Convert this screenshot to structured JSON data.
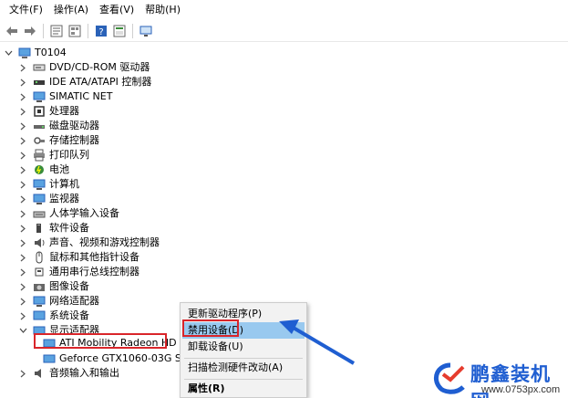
{
  "menubar": {
    "items": [
      "文件(F)",
      "操作(A)",
      "查看(V)",
      "帮助(H)"
    ]
  },
  "toolbar": {
    "buttons": [
      "back-icon",
      "forward-icon",
      "properties-icon",
      "help-icon",
      "update-icon",
      "monitor-icon"
    ]
  },
  "tree": {
    "root": "T0104",
    "items": [
      {
        "label": "DVD/CD-ROM 驱动器",
        "icon": "dvd-icon"
      },
      {
        "label": "IDE ATA/ATAPI 控制器",
        "icon": "ide-icon"
      },
      {
        "label": "SIMATIC NET",
        "icon": "network-icon"
      },
      {
        "label": "处理器",
        "icon": "cpu-icon"
      },
      {
        "label": "磁盘驱动器",
        "icon": "disk-icon"
      },
      {
        "label": "存储控制器",
        "icon": "storage-icon"
      },
      {
        "label": "打印队列",
        "icon": "printer-icon"
      },
      {
        "label": "电池",
        "icon": "battery-icon"
      },
      {
        "label": "计算机",
        "icon": "computer-icon"
      },
      {
        "label": "监视器",
        "icon": "monitor-icon"
      },
      {
        "label": "人体学输入设备",
        "icon": "hid-icon"
      },
      {
        "label": "软件设备",
        "icon": "software-icon"
      },
      {
        "label": "声音、视频和游戏控制器",
        "icon": "sound-icon"
      },
      {
        "label": "鼠标和其他指针设备",
        "icon": "mouse-icon"
      },
      {
        "label": "通用串行总线控制器",
        "icon": "usb-icon"
      },
      {
        "label": "图像设备",
        "icon": "camera-icon"
      },
      {
        "label": "网络适配器",
        "icon": "network-icon"
      },
      {
        "label": "系统设备",
        "icon": "system-icon"
      },
      {
        "label": "显示适配器",
        "icon": "display-icon"
      }
    ],
    "display_children": [
      "ATI Mobility Radeon HD",
      "Geforce GTX1060-03G Se"
    ],
    "last_item": "音频输入和输出"
  },
  "context_menu": {
    "items": [
      "更新驱动程序(P)",
      "禁用设备(D)",
      "卸载设备(U)",
      "扫描检测硬件改动(A)",
      "属性(R)"
    ]
  },
  "watermark": {
    "title": "鹏鑫装机网",
    "url": "www.0753px.com"
  },
  "colors": {
    "highlight": "#99c9ef",
    "annotation_red": "#d9252a",
    "arrow_blue": "#1f5ed1"
  }
}
